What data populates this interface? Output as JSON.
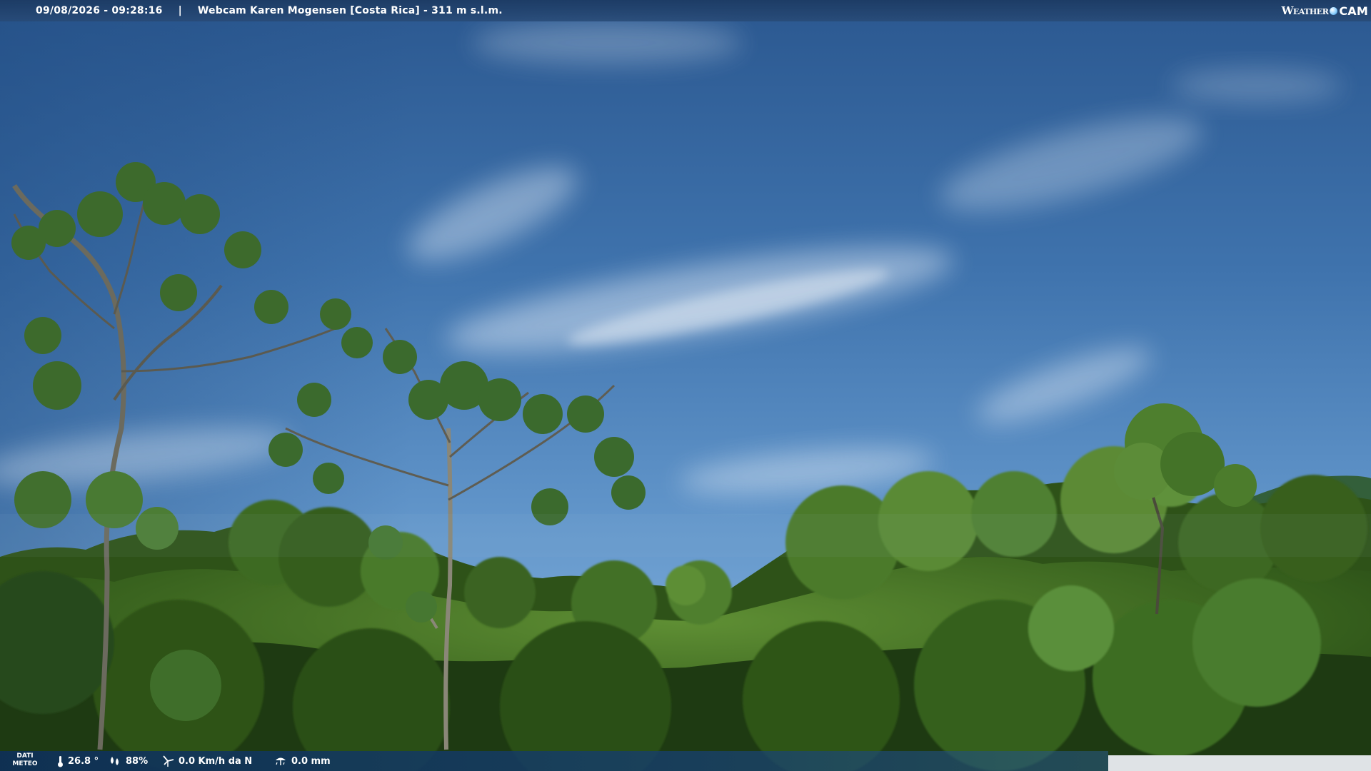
{
  "overlay": {
    "datetime": "09/08/2026 - 09:28:16",
    "separator": "|",
    "title": "Webcam Karen Mogensen [Costa Rica]  - 311 m s.l.m.",
    "logo": {
      "word": "Weather",
      "word2": "CAM"
    }
  },
  "weather_bar": {
    "label_line1": "DATI",
    "label_line2": "METEO",
    "temperature": "26.8 °",
    "humidity": "88%",
    "wind": "0.0 Km/h da N",
    "rain": "0.0 mm",
    "icons": {
      "temperature": "thermometer-icon",
      "humidity": "humidity-drops-icon",
      "wind": "wind-turbine-icon",
      "rain": "rain-gauge-icon"
    }
  },
  "colors": {
    "sky_top": "#2c5a92",
    "sky_mid": "#4f86c2",
    "sky_horizon": "#79a9d8",
    "foliage_dark": "#1f3a14",
    "foliage_mid": "#3f6a22",
    "foliage_light": "#6f9a3c",
    "bar": "#183e6c"
  }
}
